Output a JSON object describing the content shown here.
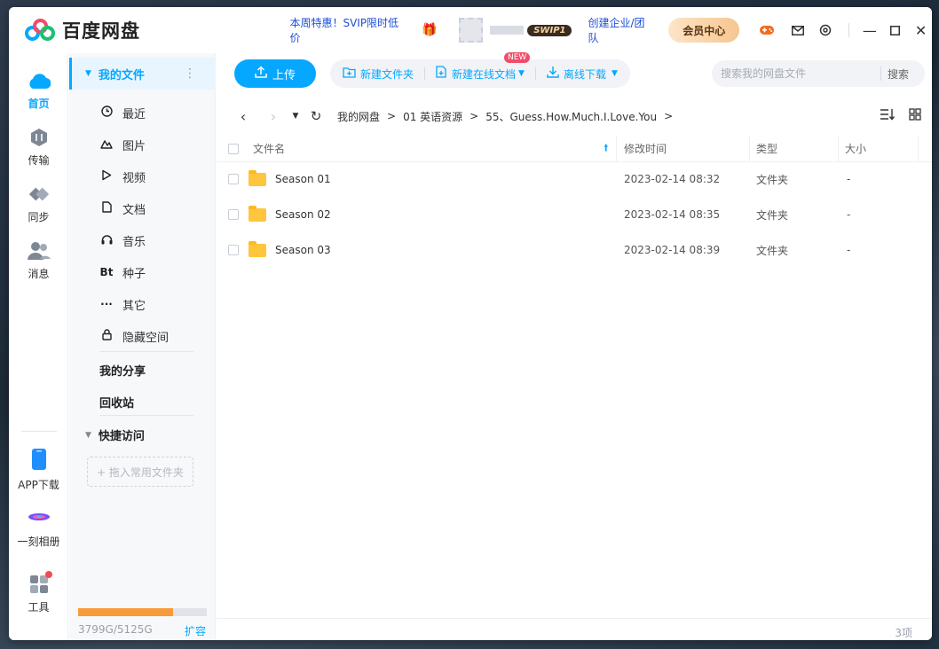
{
  "app": {
    "name": "百度网盘",
    "promo": "本周特惠！SVIP限时低价",
    "vip_badge": "SWIP1",
    "team_link": "创建企业/团队",
    "member_center": "会员中心"
  },
  "rail": {
    "items": [
      {
        "label": "首页",
        "icon": "cloud-icon",
        "active": true
      },
      {
        "label": "传输",
        "icon": "transfer-icon"
      },
      {
        "label": "同步",
        "icon": "sync-icon"
      },
      {
        "label": "消息",
        "icon": "message-icon"
      }
    ],
    "bottom": [
      {
        "label": "APP下载",
        "icon": "phone-icon"
      },
      {
        "label": "一刻相册",
        "icon": "album-icon"
      },
      {
        "label": "工具",
        "icon": "tools-icon"
      }
    ]
  },
  "sidebar": {
    "header": "我的文件",
    "items": [
      {
        "label": "最近",
        "icon": "clock-icon"
      },
      {
        "label": "图片",
        "icon": "picture-icon"
      },
      {
        "label": "视频",
        "icon": "video-icon"
      },
      {
        "label": "文档",
        "icon": "document-icon"
      },
      {
        "label": "音乐",
        "icon": "headphones-icon"
      },
      {
        "label": "种子",
        "icon": "bt-icon",
        "glyph": "Bt"
      },
      {
        "label": "其它",
        "icon": "more-icon"
      },
      {
        "label": "隐藏空间",
        "icon": "lock-icon"
      }
    ],
    "my_share": "我的分享",
    "recycle": "回收站",
    "quick_access": "快捷访问",
    "drop_hint": "+ 拖入常用文件夹",
    "quota_text": "3799G/5125G",
    "quota_used_fraction": 0.741,
    "expand": "扩容"
  },
  "toolbar": {
    "upload": "上传",
    "new_folder": "新建文件夹",
    "new_doc": "新建在线文档",
    "new_tag": "NEW",
    "offline_download": "离线下载",
    "search_placeholder": "搜索我的网盘文件",
    "search_button": "搜索"
  },
  "breadcrumb": [
    "我的网盘",
    "01 英语资源",
    "55、Guess.How.Much.I.Love.You"
  ],
  "table": {
    "headers": {
      "name": "文件名",
      "modified": "修改时间",
      "type": "类型",
      "size": "大小"
    },
    "rows": [
      {
        "name": "Season 01",
        "modified": "2023-02-14 08:32",
        "type": "文件夹",
        "size": "-"
      },
      {
        "name": "Season 02",
        "modified": "2023-02-14 08:35",
        "type": "文件夹",
        "size": "-"
      },
      {
        "name": "Season 03",
        "modified": "2023-02-14 08:39",
        "type": "文件夹",
        "size": "-"
      }
    ]
  },
  "footer": {
    "count": "3项"
  },
  "colors": {
    "accent": "#06a7ff",
    "quota": "#f79a3a",
    "folder": "#ffc53d"
  }
}
